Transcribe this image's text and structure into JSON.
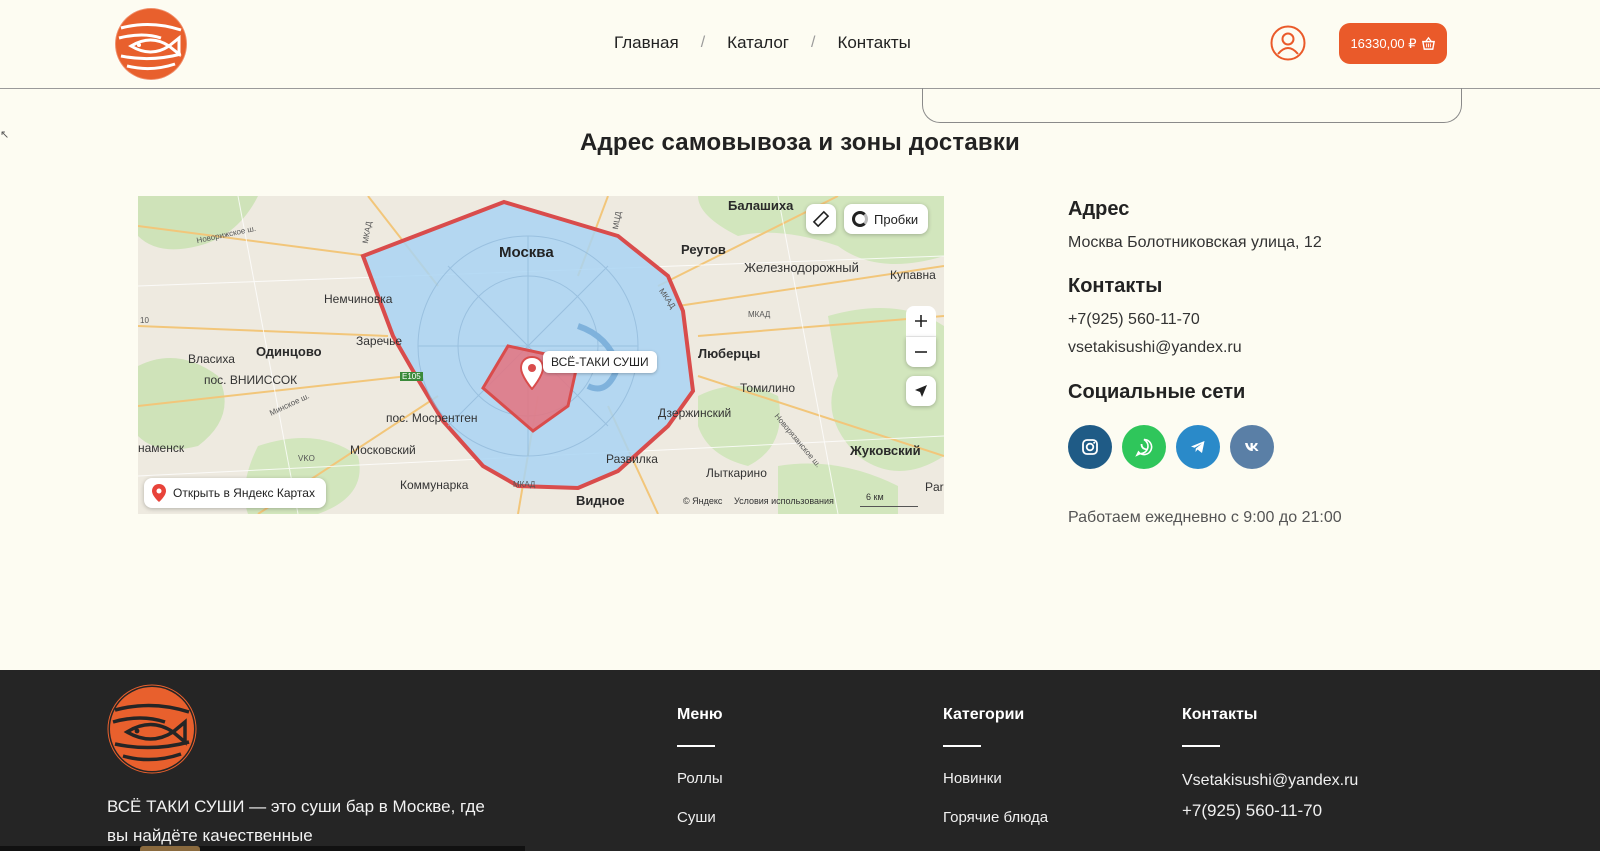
{
  "header": {
    "nav": [
      {
        "label": "Главная"
      },
      {
        "label": "Каталог"
      },
      {
        "label": "Контакты"
      }
    ],
    "separator": "/",
    "cart_total": "16330,00 ₽"
  },
  "section": {
    "title": "Адрес самовывоза и зоны доставки"
  },
  "map": {
    "labels": {
      "moscow": "Москва",
      "balashikha": "Балашиха",
      "reutov": "Реутов",
      "zheleznodorozhny": "Железнодорожный",
      "kupavna": "Купавна",
      "nemchinovka": "Немчиновка",
      "zarechye": "Заречье",
      "odintsovo": "Одинцово",
      "vlasikha": "Власиха",
      "vniissok": "пос. ВНИИССОК",
      "lyubertsy": "Люберцы",
      "tomilino": "Томилино",
      "dzerzhinsky": "Дзержинский",
      "mosrentgen": "пос. Мосрентген",
      "moskovsky": "Московский",
      "znamensk": "наменск",
      "zhukovsky": "Жуковский",
      "razvilka": "Развилка",
      "lytkarino": "Лыткарино",
      "kommunarka": "Коммунарка",
      "vidnoe": "Видное",
      "par": "Par",
      "vko": "VKO",
      "e105": "E105",
      "mkad": "МКАД",
      "mkad2": "МКАД",
      "mkad3": "МКАД",
      "mkad4": "МКАД",
      "minskoe": "Минское ш.",
      "novorizhskoe": "Новорижское ш.",
      "novoryazanskoe": "Новорязанское ш.",
      "mtsd": "МЦД",
      "ten": "10"
    },
    "pin_label": "ВСЁ-ТАКИ СУШИ",
    "traffic_label": "Пробки",
    "open_label": "Открыть в Яндекс Картах",
    "copyright": "© Яндекс",
    "terms": "Условия использования",
    "scale": "6 км",
    "colors": {
      "zone_fill": "#a9d3f3",
      "zone_stroke": "#d94c4c",
      "inner_fill": "#e4737f"
    }
  },
  "info": {
    "address_heading": "Адрес",
    "address": "Москва Болотниковская улица, 12",
    "contacts_heading": "Контакты",
    "phone": "+7(925) 560-11-70",
    "email": "vsetakisushi@yandex.ru",
    "social_heading": "Социальные сети",
    "social": [
      {
        "icon": "instagram-icon",
        "color": "#1f5b86"
      },
      {
        "icon": "whatsapp-icon",
        "color": "#2fc65b"
      },
      {
        "icon": "telegram-icon",
        "color": "#2a8ac9"
      },
      {
        "icon": "vk-icon",
        "color": "#5a7fa6"
      }
    ],
    "hours": "Работаем ежедневно с 9:00 до 21:00"
  },
  "footer": {
    "about": "ВСЁ ТАКИ СУШИ — это суши бар в Москве, где вы найдёте качественные",
    "menu_heading": "Меню",
    "menu_items": [
      "Роллы",
      "Суши"
    ],
    "categories_heading": "Категории",
    "categories_items": [
      "Новинки",
      "Горячие блюда"
    ],
    "contacts_heading": "Контакты",
    "contacts_email": "Vsetakisushi@yandex.ru",
    "contacts_phone": "+7(925) 560-11-70"
  },
  "colors": {
    "accent": "#ea5a2a",
    "background": "#fdfcf2",
    "footer": "#252525"
  }
}
